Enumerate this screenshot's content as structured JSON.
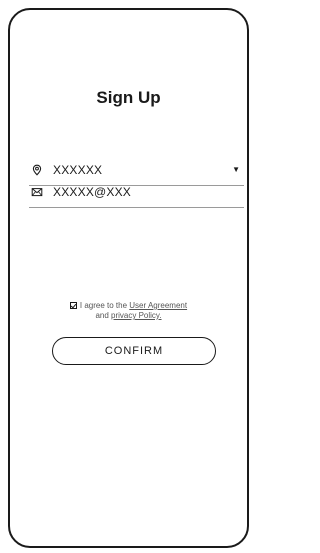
{
  "title": "Sign Up",
  "fields": {
    "location": {
      "value": "XXXXXX",
      "icon": "location-pin-icon",
      "caret": "▼"
    },
    "email": {
      "value": "XXXXX@XXX",
      "icon": "envelope-icon"
    }
  },
  "agreement": {
    "prefix": "I agree to the ",
    "user_agreement": "User Agreement",
    "middle": "and ",
    "privacy_policy": "privacy Policy."
  },
  "confirm_label": "CONFIRM"
}
